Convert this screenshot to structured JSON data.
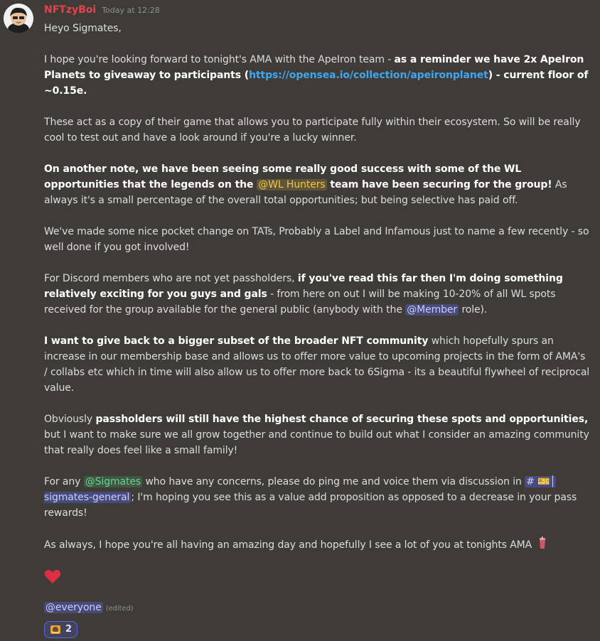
{
  "message": {
    "username": "NFTzyBoi",
    "timestamp": "Today at 12:28",
    "greeting": "Heyo Sigmates,",
    "p1": {
      "a": "I hope you're looking forward to tonight's AMA with the ApeIron team - ",
      "b1": "as a reminder we have 2x ApeIron Planets to giveaway to participants (",
      "link": "https://opensea.io/collection/apeironplanet",
      "b2": ") - current floor of ~0.15e."
    },
    "p2": "These act as a copy of their game that allows you to participate fully within their ecosystem. So will be really cool to test out and have a look around if you're a lucky winner.",
    "p3": {
      "b1": "On another note, we have been seeing some really good success with some of the WL opportunities that the legends on the ",
      "mention": "@WL Hunters",
      "b2": " team have been securing for the group!",
      "rest": " As always it's a small percentage of the overall total opportunities; but being selective has paid off."
    },
    "p4": "We've made some nice pocket change on TATs, Probably a Label and Infamous just to name a few recently - so well done if you got involved!",
    "p5": {
      "a": "For Discord members who are not yet passholders, ",
      "b": "if you've read this far then I'm doing something relatively exciting for you guys and gals",
      "c": " - from here on out I will be making 10-20% of all WL spots received for the group available for the general public (anybody with the ",
      "mention": "@Member",
      "d": " role)."
    },
    "p6": {
      "b": "I want to give back to a bigger subset of the broader NFT community",
      "rest": " which hopefully spurs an increase in our membership base and allows us to offer more value to upcoming projects in the form of AMA's / collabs etc which in time will also allow us to offer more back to 6Sigma - its a beautiful flywheel of reciprocal value."
    },
    "p7": {
      "a": "Obviously ",
      "b": "passholders will still have the highest chance of securing these spots and opportunities,",
      "rest": " but I want to make sure we all grow together and continue to build out what I consider an amazing community that really does feel like a small family!"
    },
    "p8": {
      "a": "For any ",
      "mention": "@Sigmates",
      "b": " who have any concerns, please do ping me and voice them via discussion in ",
      "channel_prefix": "# 🎫│",
      "channel": "sigmates-general",
      "c": "; I'm hoping you see this as a value add proposition as opposed to a decrease in your pass rewards!"
    },
    "p9": "As always, I hope you're all having an amazing day and hopefully I see a lot of you at tonights AMA",
    "everyone": "@everyone",
    "edited": "(edited)",
    "reaction_count": "2",
    "colors": {
      "username": "#e8414d",
      "link": "#3fa6f2",
      "heart": "#dd2e44"
    }
  }
}
